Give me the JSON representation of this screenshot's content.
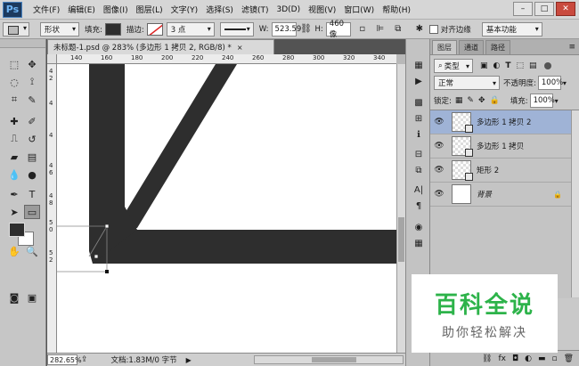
{
  "app": {
    "logo": "Ps"
  },
  "menu": [
    "文件(F)",
    "编辑(E)",
    "图像(I)",
    "图层(L)",
    "文字(Y)",
    "选择(S)",
    "滤镜(T)",
    "3D(D)",
    "视图(V)",
    "窗口(W)",
    "帮助(H)"
  ],
  "window_buttons": {
    "minimize": "–",
    "maximize": "□",
    "close": "✕"
  },
  "options": {
    "mode": "形状",
    "fill_label": "填充:",
    "fill_color": "#2e2e2e",
    "stroke_label": "描边:",
    "stroke_width": "3 点",
    "w_label": "W:",
    "w_value": "523.59",
    "h_label": "H:",
    "h_value": "460 像",
    "align_edges": "对齐边缘",
    "workspace": "基本功能"
  },
  "document": {
    "tab_title": "未标题-1.psd @ 283% (多边形 1 拷贝 2, RGB/8) *",
    "tab_close": "×",
    "ruler_h": [
      "140",
      "160",
      "180",
      "200",
      "220",
      "240",
      "260",
      "280",
      "300",
      "320",
      "340",
      "360"
    ],
    "ruler_v": [
      "4",
      "2",
      "4",
      "4",
      "4",
      "6",
      "4",
      "8",
      "5",
      "0",
      "5",
      "2"
    ],
    "shape_color": "#2e2e2e"
  },
  "status": {
    "zoom": "282.65%",
    "doc_info": "文档:1.83M/0 字节"
  },
  "panel": {
    "tabs": [
      "图层",
      "通道",
      "路径"
    ],
    "filter": "类型",
    "blend_mode": "正常",
    "opacity_label": "不透明度:",
    "opacity_value": "100%",
    "lock_label": "锁定:",
    "fill_label": "填充:",
    "fill_value": "100%",
    "layers": [
      {
        "name": "多边形 1 拷贝 2",
        "selected": true
      },
      {
        "name": "多边形 1 拷贝",
        "selected": false
      },
      {
        "name": "矩形 2",
        "selected": false
      },
      {
        "name": "背景",
        "selected": false
      }
    ]
  },
  "watermark": {
    "title": "百科全说",
    "subtitle": "助你轻松解决"
  }
}
